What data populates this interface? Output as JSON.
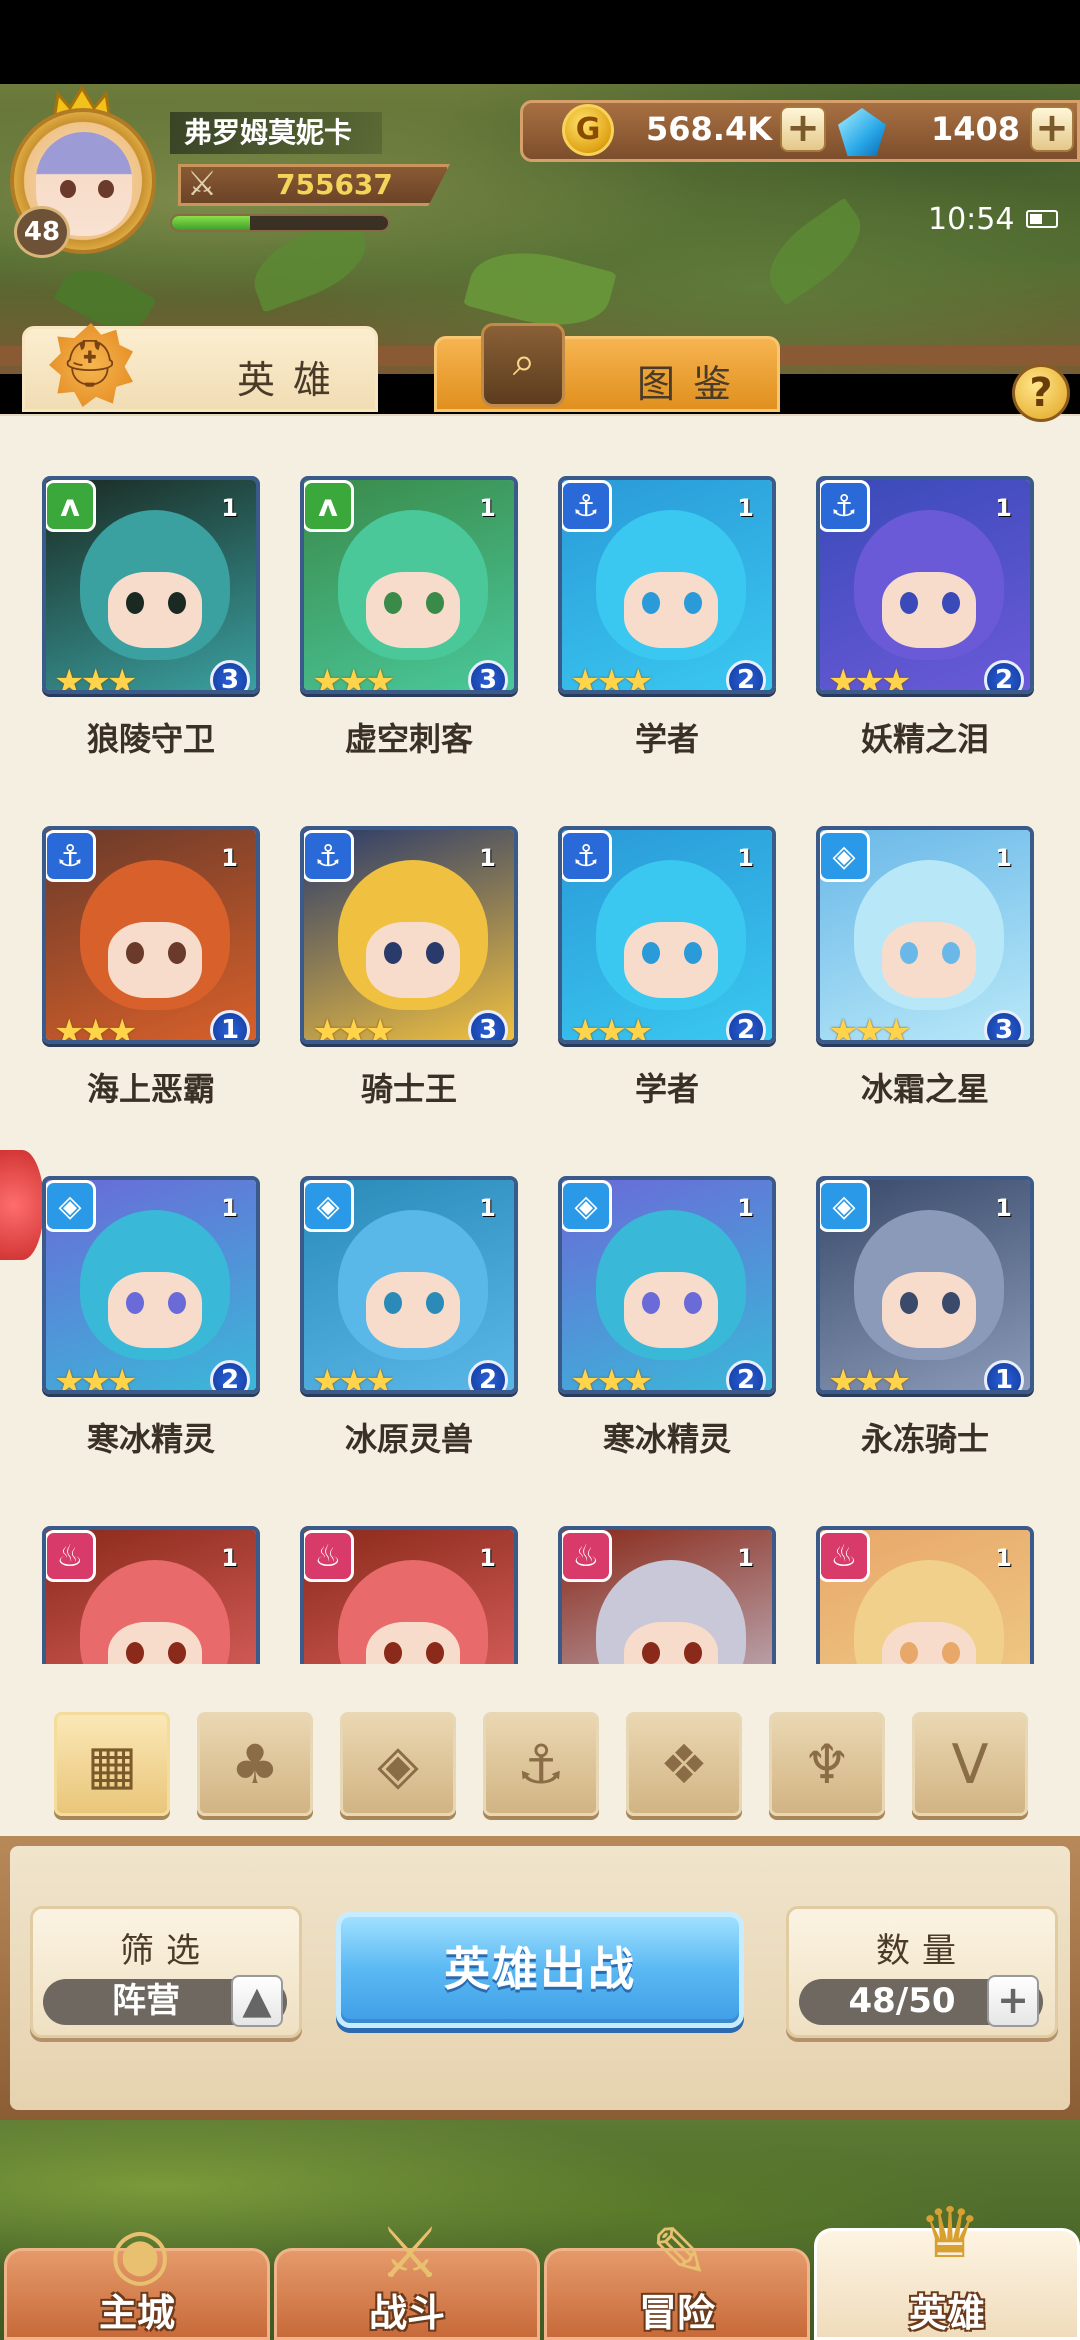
{
  "player": {
    "name": "弗罗姆莫妮卡",
    "level": "48",
    "power": "755637",
    "xp_fraction": 0.36
  },
  "currency": {
    "gold": "568.4K",
    "gems": "1408",
    "gold_icon_glyph": "G",
    "plus_glyph": "+"
  },
  "clock": {
    "time": "10:54"
  },
  "tabs": {
    "heroes": "英雄",
    "codex": "图鉴",
    "help_glyph": "?"
  },
  "heroes": [
    {
      "name": "狼陵守卫",
      "level": "1",
      "rank": "3",
      "faction": "beast",
      "stars": "★★★",
      "palette": [
        "#1a2a22",
        "#3aa0a0"
      ]
    },
    {
      "name": "虚空刺客",
      "level": "1",
      "rank": "3",
      "faction": "beast",
      "stars": "★★★",
      "palette": [
        "#3a8a4a",
        "#4ac89a"
      ]
    },
    {
      "name": "学者",
      "level": "1",
      "rank": "2",
      "faction": "anchor",
      "stars": "★★★",
      "palette": [
        "#2a9ad8",
        "#3ac8f0"
      ]
    },
    {
      "name": "妖精之泪",
      "level": "1",
      "rank": "2",
      "faction": "anchor",
      "stars": "★★★",
      "palette": [
        "#3a4ab8",
        "#6a5ad8"
      ]
    },
    {
      "name": "海上恶霸",
      "level": "1",
      "rank": "1",
      "faction": "anchor",
      "stars": "★★★",
      "palette": [
        "#6a3a2a",
        "#d8602a"
      ]
    },
    {
      "name": "骑士王",
      "level": "1",
      "rank": "3",
      "faction": "anchor",
      "stars": "★★★",
      "palette": [
        "#2a3a6a",
        "#f0c040"
      ]
    },
    {
      "name": "学者",
      "level": "1",
      "rank": "2",
      "faction": "anchor",
      "stars": "★★★",
      "palette": [
        "#2a9ad8",
        "#3ac8f0"
      ]
    },
    {
      "name": "冰霜之星",
      "level": "1",
      "rank": "3",
      "faction": "ice",
      "stars": "★★★",
      "palette": [
        "#6ab8e8",
        "#b8e8f8"
      ]
    },
    {
      "name": "寒冰精灵",
      "level": "1",
      "rank": "2",
      "faction": "ice",
      "stars": "★★★",
      "palette": [
        "#6a6ad8",
        "#3ab8d8"
      ]
    },
    {
      "name": "冰原灵兽",
      "level": "1",
      "rank": "2",
      "faction": "ice",
      "stars": "★★★",
      "palette": [
        "#2a8ab8",
        "#5ab8e8"
      ]
    },
    {
      "name": "寒冰精灵",
      "level": "1",
      "rank": "2",
      "faction": "ice",
      "stars": "★★★",
      "palette": [
        "#6a6ad8",
        "#3ab8d8"
      ]
    },
    {
      "name": "永冻骑士",
      "level": "1",
      "rank": "1",
      "faction": "ice",
      "stars": "★★★",
      "palette": [
        "#3a4a6a",
        "#8a9ab8"
      ]
    },
    {
      "name": "",
      "level": "1",
      "rank": "",
      "faction": "fire",
      "stars": "",
      "palette": [
        "#8a2a1a",
        "#e86a6a"
      ]
    },
    {
      "name": "",
      "level": "1",
      "rank": "",
      "faction": "fire",
      "stars": "",
      "palette": [
        "#8a2a1a",
        "#e86a6a"
      ]
    },
    {
      "name": "",
      "level": "1",
      "rank": "",
      "faction": "fire",
      "stars": "",
      "palette": [
        "#8a2a1a",
        "#c8c8d8"
      ]
    },
    {
      "name": "",
      "level": "1",
      "rank": "",
      "faction": "fire",
      "stars": "",
      "palette": [
        "#e8a86a",
        "#f0d08a"
      ]
    }
  ],
  "faction_badges": {
    "beast": {
      "glyph": "ʌ",
      "color": "#3aa83a"
    },
    "anchor": {
      "glyph": "⚓",
      "color": "#2a6ad8"
    },
    "ice": {
      "glyph": "◈",
      "color": "#2a9ae8"
    },
    "fire": {
      "glyph": "♨",
      "color": "#d83a6a"
    }
  },
  "filters": [
    {
      "name": "all-filter",
      "glyph": "▦",
      "icon": "grid-icon",
      "active": true
    },
    {
      "name": "nature-filter",
      "glyph": "♣",
      "icon": "sprout-icon",
      "active": false
    },
    {
      "name": "ice-filter",
      "glyph": "◈",
      "icon": "ice-crystal-icon",
      "active": false
    },
    {
      "name": "anchor-filter",
      "glyph": "⚓",
      "icon": "anchor-icon",
      "active": false
    },
    {
      "name": "beast-filter",
      "glyph": "❖",
      "icon": "beast-head-icon",
      "active": false
    },
    {
      "name": "dark-filter",
      "glyph": "♆",
      "icon": "demon-horns-icon",
      "active": false
    },
    {
      "name": "light-filter",
      "glyph": "V",
      "icon": "wings-icon",
      "active": false
    }
  ],
  "controls": {
    "filter_title": "筛选",
    "filter_value": "阵营",
    "filter_toggle_glyph": "▲",
    "deploy_label": "英雄出战",
    "count_title": "数量",
    "count_value": "48/50",
    "count_plus_glyph": "+"
  },
  "nav": [
    {
      "label": "主城",
      "icon": "castle-icon",
      "glyph": "◉",
      "active": false
    },
    {
      "label": "战斗",
      "icon": "crossed-swords-icon",
      "glyph": "⚔",
      "active": false
    },
    {
      "label": "冒险",
      "icon": "scroll-map-icon",
      "glyph": "✎",
      "active": false
    },
    {
      "label": "英雄",
      "icon": "hero-crest-icon",
      "glyph": "♛",
      "active": true
    }
  ]
}
